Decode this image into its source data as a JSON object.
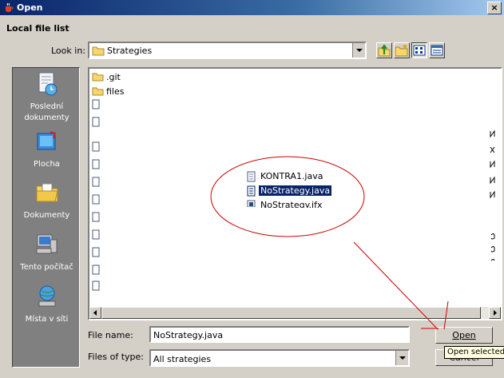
{
  "window": {
    "title": "Open",
    "close_glyph": "×"
  },
  "dialog": {
    "heading": "Local file list"
  },
  "look_in": {
    "label": "Look in:",
    "value": "Strategies"
  },
  "places": [
    {
      "label_lines": [
        "Poslední",
        "dokumenty"
      ]
    },
    {
      "label_lines": [
        "Plocha"
      ]
    },
    {
      "label_lines": [
        "Dokumenty"
      ]
    },
    {
      "label_lines": [
        "Tento počítač"
      ]
    },
    {
      "label_lines": [
        "Místa v síti"
      ]
    }
  ],
  "files": {
    "folders": [
      ".git",
      "files"
    ],
    "highlighted": [
      "KONTRA1.java",
      "NoStrategy.java",
      "NoStrategy.jfx"
    ],
    "selected": "NoStrategy.java"
  },
  "file_name": {
    "label": "File name:",
    "value": "NoStrategy.java"
  },
  "file_type": {
    "label": "Files of type:",
    "value": "All strategies"
  },
  "buttons": {
    "open": "Open",
    "cancel": "Cancel"
  },
  "tooltip": "Open selected",
  "annotation": {
    "color": "#cc0000"
  },
  "colors": {
    "selection": "#0a246a",
    "title_bar": "#0a246a",
    "face": "#d4d0c8"
  }
}
